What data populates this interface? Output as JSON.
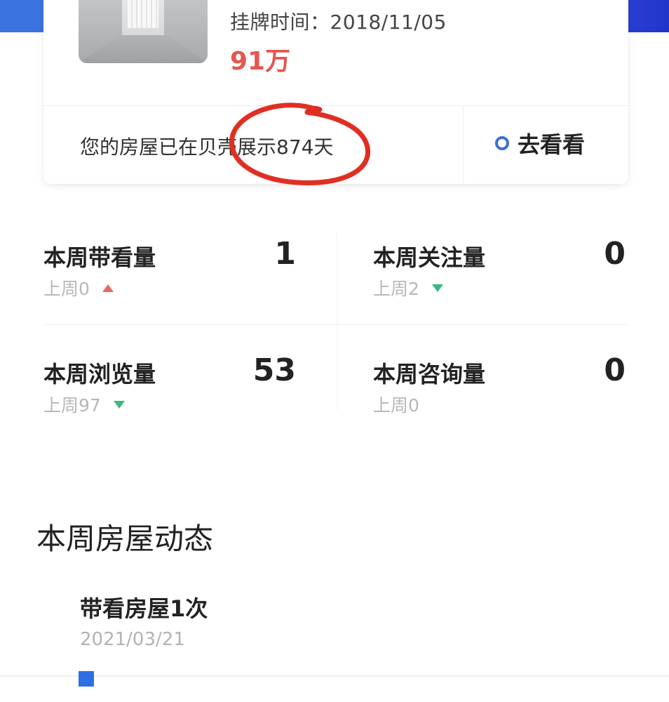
{
  "listing": {
    "date_label": "挂牌时间：2018/11/05",
    "price": "91万"
  },
  "display_banner": {
    "text": "您的房屋已在贝壳展示874天",
    "action_label": "去看看"
  },
  "stats": [
    {
      "title": "本周带看量",
      "value": "1",
      "prev": "上周0",
      "trend": "up"
    },
    {
      "title": "本周关注量",
      "value": "0",
      "prev": "上周2",
      "trend": "down"
    },
    {
      "title": "本周浏览量",
      "value": "53",
      "prev": "上周97",
      "trend": "down"
    },
    {
      "title": "本周咨询量",
      "value": "0",
      "prev": "上周0",
      "trend": "none"
    }
  ],
  "weekly_activity": {
    "title": "本周房屋动态",
    "events": [
      {
        "title": "带看房屋1次",
        "date": "2021/03/21"
      }
    ]
  },
  "colors": {
    "price_red": "#e4574f",
    "accent_blue": "#3a6fd6",
    "trend_up": "#e66a61",
    "trend_down": "#3eb882",
    "annotation_red": "#e02f22"
  }
}
